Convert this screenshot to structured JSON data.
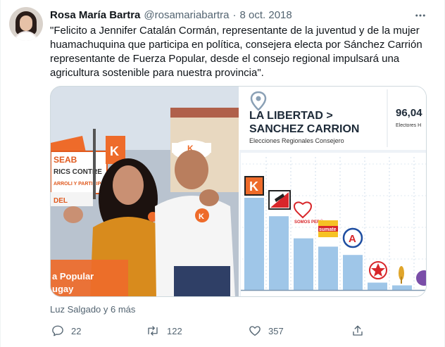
{
  "tweet": {
    "display_name": "Rosa María Bartra",
    "handle": "@rosamariabartra",
    "separator": "·",
    "date": "8 oct. 2018",
    "text": "\"Felicito a Jennifer Catalán Cormán, representante de la juventud y de la mujer huamachuquina que participa en política, consejera electa por Sánchez Carrión representante de Fuerza Popular, desde el consejo regional impulsará una agricultura sostenible para nuestra provincia\".",
    "liked_by": "Luz Salgado y 6 más"
  },
  "photo": {
    "banner_text_line1": "a Popular",
    "banner_text_line2": "ugay",
    "poster_text_1": "SEAB",
    "poster_text_2": "RICS CONTRE",
    "poster_text_3": "ARROLI Y PARTICIPA",
    "poster_text_4": "DEL",
    "logo_letter": "K",
    "cap_letter": "K"
  },
  "graphic": {
    "title_line1": "LA LIBERTAD >",
    "title_line2": "SANCHEZ CARRION",
    "subtitle": "Elecciones Regionales Consejero",
    "stat_value": "96,04",
    "stat_label": "Electores H",
    "bar_color": "#9fc6e8",
    "party_labels": [
      "K",
      "",
      "SOMOS PERÚ",
      "sumate",
      "A",
      "",
      ""
    ],
    "bars": [
      100,
      80,
      56,
      47,
      38,
      8,
      5
    ]
  },
  "actions": {
    "reply_count": "22",
    "retweet_count": "122",
    "like_count": "357"
  },
  "icons": [
    "more-icon",
    "reply-icon",
    "retweet-icon",
    "like-icon",
    "share-icon",
    "location-pin-icon"
  ]
}
